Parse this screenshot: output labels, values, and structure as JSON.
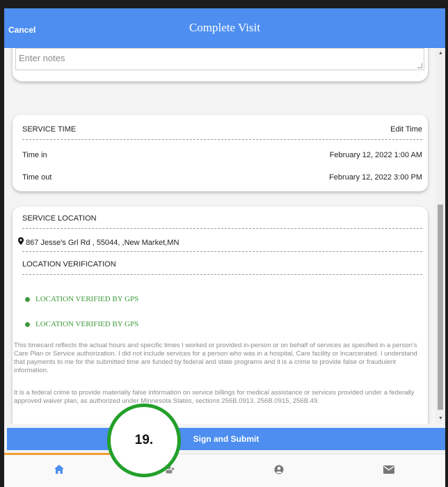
{
  "header": {
    "cancel_label": "Cancel",
    "title": "Complete Visit"
  },
  "notes": {
    "placeholder": "Enter notes"
  },
  "service_time": {
    "heading": "SERVICE TIME",
    "edit_label": "Edit Time",
    "time_in_label": "Time in",
    "time_in_value": "February 12, 2022 1:00 AM",
    "time_out_label": "Time out",
    "time_out_value": "February 12, 2022 3:00 PM"
  },
  "service_location": {
    "heading": "SERVICE LOCATION",
    "address": "867 Jesse's Grl Rd , 55044, ,New Market,MN",
    "verification_heading": "LOCATION VERIFICATION",
    "verified_1": "LOCATION VERIFIED BY GPS",
    "verified_2": "LOCATION VERIFIED BY GPS"
  },
  "legal": {
    "para1": "This timecard reflects the actual hours and specific times I worked or provided in-person or on behalf of services as specified in a person's Care Plan or Service authorization. I did not include services for a person who was in a hospital, Care facility or Incarcerated. I understand that payments to me for the submitted time are funded by federal and state programs and it is a crime to provide false or fraudulent information.",
    "para2": "It is a federal crime to provide materially false information on service billings for medical assistance or services provided under a federally approved waiver plan, as authorized under Minnesota States, sections 256B.0913, 256B.0915, 256B.49."
  },
  "submit_label": "Sign and Submit",
  "nav": {
    "items": [
      "home-icon",
      "team-icon",
      "account-icon",
      "mail-icon"
    ],
    "active_color": "#f0a030"
  },
  "annotation": {
    "step_label": "19.",
    "ring_color": "#22a02a"
  },
  "colors": {
    "brand": "#4d8ef0",
    "verified": "#3e9a3a"
  }
}
